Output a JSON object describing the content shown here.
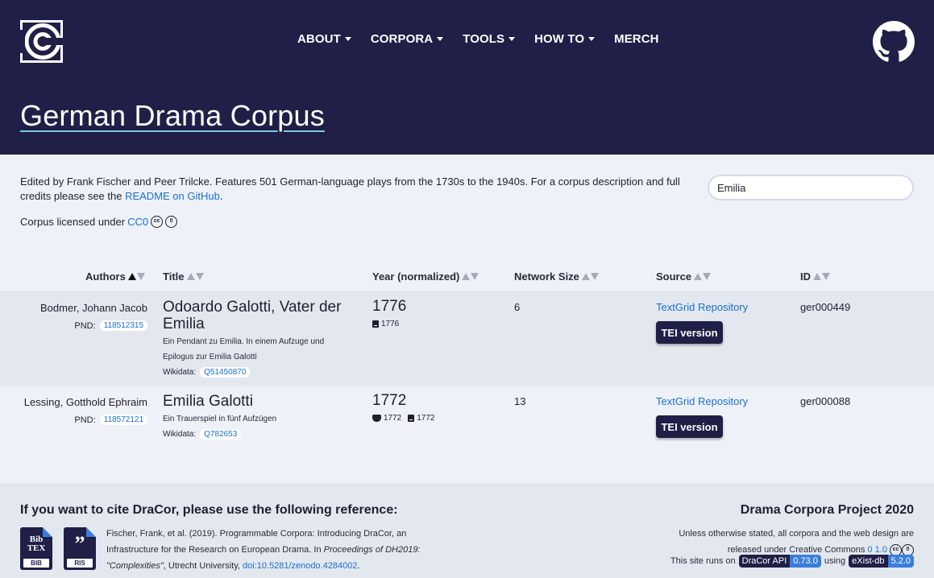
{
  "nav": {
    "items": [
      {
        "label": "ABOUT",
        "dropdown": true
      },
      {
        "label": "CORPORA",
        "dropdown": true
      },
      {
        "label": "TOOLS",
        "dropdown": true
      },
      {
        "label": "HOW TO",
        "dropdown": true
      },
      {
        "label": "MERCH",
        "dropdown": false
      }
    ]
  },
  "page": {
    "title": "German Drama Corpus"
  },
  "intro": {
    "text_before_link": "Edited by Frank Fischer and Peer Trilcke. Features 501 German-language plays from the 1730s to the 1940s. For a corpus description and full credits please see the ",
    "readme_link": "README on GitHub",
    "text_after_link": ".",
    "license_prefix": "Corpus licensed under ",
    "license_link": "CC0"
  },
  "search": {
    "value": "Emilia"
  },
  "table": {
    "headers": {
      "authors": "Authors",
      "title": "Title",
      "year": "Year (normalized)",
      "network": "Network Size",
      "source": "Source",
      "id": "ID"
    },
    "rows": [
      {
        "author": "Bodmer, Johann Jacob",
        "pnd_label": "PND:",
        "pnd": "118512315",
        "title_line1": "Odoardo Galotti, Vater der",
        "title_line2": "Emilia",
        "subtitle": "Ein Pendant zu Emilia. In einem Aufzuge und Epilogus zur Emilia Galotti",
        "wikidata_label": "Wikidata:",
        "wikidata": "Q51450870",
        "year": "1776",
        "printed": "1776",
        "network_size": "6",
        "source": "TextGrid Repository",
        "tei": "TEI version",
        "id": "ger000449"
      },
      {
        "author": "Lessing, Gotthold Ephraim",
        "pnd_label": "PND:",
        "pnd": "118572121",
        "title_line1": "Emilia Galotti",
        "subtitle": "Ein Trauerspiel in fünf Aufzügen",
        "wikidata_label": "Wikidata:",
        "wikidata": "Q782653",
        "year": "1772",
        "premiere": "1772",
        "printed": "1772",
        "network_size": "13",
        "source": "TextGrid Repository",
        "tei": "TEI version",
        "id": "ger000088"
      }
    ]
  },
  "footer": {
    "cite_heading": "If you want to cite DraCor, please use the following reference:",
    "bib_label": "BIB",
    "ris_label": "RIS",
    "cite_text_1": "Fischer, Frank, et al. (2019). Programmable Corpora: Introducing DraCor, an Infrastructure for the Research on European Drama. In ",
    "cite_italic_1": "Proceedings of DH2019: \"Complexities\"",
    "cite_text_2": ", Utrecht University, ",
    "cite_doi": "doi:10.5281/zenodo.4284002",
    "cite_text_3": ".",
    "project_heading": "Drama Corpora Project 2020",
    "project_text_1": "Unless otherwise stated, all corpora and the web design are released under Creative Commons ",
    "project_cc_link": "0 1.0",
    "runs_prefix": "This site runs on",
    "api_name": "DraCor API",
    "api_version": "0.73.0",
    "using": "using",
    "db_name": "eXist-db",
    "db_version": "5.2.0"
  },
  "colors": {
    "header_bg": "#1f1f48",
    "link": "#1a6fd1",
    "accent": "#3b7ddd"
  }
}
